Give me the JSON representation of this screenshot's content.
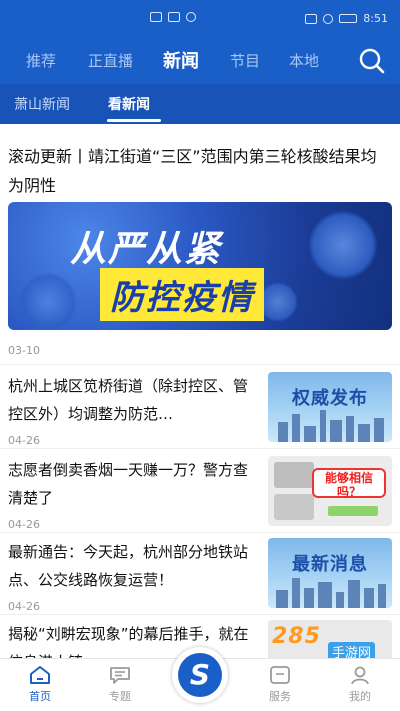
{
  "status_bar": {
    "time": "8:51"
  },
  "top_nav": {
    "tabs": [
      {
        "label": "推荐"
      },
      {
        "label": "正直播"
      },
      {
        "label": "新闻",
        "active": true
      },
      {
        "label": "节目"
      },
      {
        "label": "本地"
      }
    ],
    "search_icon": "search-icon"
  },
  "sub_nav": {
    "tabs": [
      {
        "label": "萧山新闻"
      },
      {
        "label": "看新闻",
        "active": true
      }
    ]
  },
  "feed": {
    "headline": {
      "title": "滚动更新丨靖江街道“三区”范围内第三轮核酸结果均为阴性",
      "banner_line1": "从严从紧",
      "banner_line2": "防控疫情",
      "date": "03-10"
    },
    "items": [
      {
        "title": "杭州上城区笕桥街道（除封控区、管控区外）均调整为防范…",
        "date": "04-26",
        "thumb_text": "权威发布"
      },
      {
        "title": "志愿者倒卖香烟一天赚一万？警方查清楚了",
        "date": "04-26",
        "thumb_text": "能够相信吗？"
      },
      {
        "title": "最新通告：今天起，杭州部分地铁站点、公交线路恢复运营！",
        "date": "04-26",
        "thumb_text": "最新消息"
      },
      {
        "title": "揭秘“刘畊宏现象”的幕后推手，就在信息港小镇",
        "date": "",
        "thumb_text": ""
      }
    ]
  },
  "bottom_nav": {
    "items": [
      {
        "label": "首页",
        "icon": "home-icon",
        "active": true
      },
      {
        "label": "专题",
        "icon": "chat-icon"
      },
      {
        "label": "S",
        "icon": "app-logo-icon"
      },
      {
        "label": "服务",
        "icon": "service-icon"
      },
      {
        "label": "我的",
        "icon": "profile-icon"
      }
    ]
  },
  "watermark": {
    "number": "285",
    "site": "手游网"
  },
  "colors": {
    "brand_blue": "#1a5fc8",
    "sub_nav_blue": "#1854b8",
    "highlight_yellow": "#ffe838"
  }
}
